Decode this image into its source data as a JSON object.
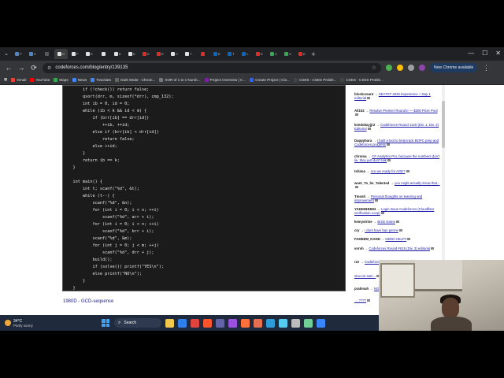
{
  "tabs": [
    {
      "title": "F",
      "color": "#4f86c6"
    },
    {
      "title": "C",
      "color": "#4f86c6"
    },
    {
      "title": "",
      "color": "#5a5a5a"
    },
    {
      "title": "G",
      "color": "#e0e0e0"
    },
    {
      "title": "F",
      "color": "#e0e0e0"
    },
    {
      "title": "E",
      "color": "#e0e0e0"
    },
    {
      "title": "",
      "color": "#e0e0e0"
    },
    {
      "title": "E",
      "color": "#e0e0e0"
    },
    {
      "title": "E",
      "color": "#e0e0e0"
    },
    {
      "title": "E",
      "color": "#d93025"
    },
    {
      "title": "E",
      "color": "#d93025"
    },
    {
      "title": "C",
      "color": "#e0e0e0"
    },
    {
      "title": "T",
      "color": "#e0e0e0"
    },
    {
      "title": "",
      "color": "#d93025"
    },
    {
      "title": "E",
      "color": "#0a66c2"
    },
    {
      "title": "T",
      "color": "#0a66c2"
    },
    {
      "title": "L",
      "color": "#0a66c2"
    },
    {
      "title": "E",
      "color": "#d93025"
    },
    {
      "title": "C",
      "color": "#34a853"
    },
    {
      "title": "C",
      "color": "#34a853"
    },
    {
      "title": "E",
      "color": "#d93025"
    }
  ],
  "browser": {
    "url": "codeforces.com/blog/entry/139135",
    "update_label": "New Chrome available"
  },
  "bookmarks": [
    {
      "label": "Gmail",
      "color": "#ea4335"
    },
    {
      "label": "YouTube",
      "color": "#ff0000"
    },
    {
      "label": "Maps",
      "color": "#34a853"
    },
    {
      "label": "News",
      "color": "#4285f4"
    },
    {
      "label": "Translate",
      "color": "#4285f4"
    },
    {
      "label": "Dark Mode - Chrom...",
      "color": "#666"
    },
    {
      "label": "XOR of 1 to n Numb...",
      "color": "#777"
    },
    {
      "label": "Project Overview | C...",
      "color": "#7b1fa2"
    },
    {
      "label": "Create Project | Clo...",
      "color": "#2962ff"
    },
    {
      "label": "CSES - CSES Proble...",
      "color": "#444"
    },
    {
      "label": "CSES - CSES Proble...",
      "color": "#444"
    }
  ],
  "code_lines": [
    "        if (!check()) return false;",
    "        qsort(drr, m, sizeof(*drr), cmp_132);",
    "        int ib = 0, id = 0;",
    "        while (ib < k && id < m) {",
    "            if (brr[ib] == drr[id])",
    "                ++ib, ++id;",
    "            else if (brr[ib] < drr[id])",
    "                return false;",
    "            else ++id;",
    "        }",
    "        return ib == k;",
    "    }",
    "",
    "    int main() {",
    "        int t; scanf(\"%d\", &t);",
    "        while (t--) {",
    "            scanf(\"%d\", &n);",
    "            for (int i = 0; i < n; ++i)",
    "                scanf(\"%d\", arr + i);",
    "            for (int i = 0; i < n; ++i)",
    "                scanf(\"%d\", brr + i);",
    "            scanf(\"%d\", &m);",
    "            for (int j = 0; j < m; ++j)",
    "                scanf(\"%d\", drr + j);",
    "            build();",
    "            if (solve()) printf(\"YES\\n\");",
    "            else printf(\"NO\\n\");",
    "        }",
    "    }"
  ],
  "problem_link": "1980D - GCD-sequence",
  "sidebar": [
    {
      "user": "blockcreant",
      "title": "SEATST 2026 Experience + Day 1 editorial"
    },
    {
      "user": "Ali102",
      "title": "Resolve Premier Round II — $300 Prize Pool"
    },
    {
      "user": "kendokayjjr2",
      "title": "Codeforces Round 1120 (Div. 1, Div. 2) Editorial"
    },
    {
      "user": "Dappybara",
      "title": "I built a tool to help track BOPC prep and Codeforces progress"
    },
    {
      "user": "chroma",
      "title": "CF Analytics Pro, because the numbers don't lie, they just don't talk"
    },
    {
      "user": "tshimo",
      "title": "Are we ready for AGE?"
    },
    {
      "user": "want_To_be_Talented",
      "title": "you might actually know that..."
    },
    {
      "user": "Tmosh",
      "title": "Personal thoughts on learning and improvement"
    },
    {
      "user": "YAHHHHHHH",
      "title": "Login Issue Codeforces (Cloudflare verification Loop)"
    },
    {
      "user": "kemystrine",
      "title": "Brick Game"
    },
    {
      "user": "cry",
      "title": "i dont have ban perms"
    },
    {
      "user": "FAHEEM_KAHH",
      "title": "NEED HELP!!"
    },
    {
      "user": "vnrvh",
      "title": "Codeforces Round #615 (Div. 3) editorial"
    },
    {
      "user": "rze",
      "title": "Codeforces Round 1114 (Div. 3) editorial"
    },
    {
      "user": "",
      "title": "stuv.cin.sam..."
    },
    {
      "user": "prahmah",
      "title": "NGO Open C..."
    },
    {
      "user": "",
      "title": "→ ????"
    }
  ],
  "taskbar": {
    "temp": "34°C",
    "condition": "Partly sunny",
    "search_label": "Search",
    "apps": [
      {
        "name": "file-explorer-icon",
        "color": "#f2c94c"
      },
      {
        "name": "vscode-icon",
        "color": "#2f80ed"
      },
      {
        "name": "chrome-icon",
        "color": "#e0443e"
      },
      {
        "name": "brave-icon",
        "color": "#fb542b"
      },
      {
        "name": "teams-icon",
        "color": "#6264a7"
      },
      {
        "name": "notes-icon",
        "color": "#9b51e0"
      },
      {
        "name": "firefox-icon",
        "color": "#ff7139"
      },
      {
        "name": "obs-icon",
        "color": "#e76f51"
      },
      {
        "name": "store-icon",
        "color": "#2d9cdb"
      },
      {
        "name": "photos-icon",
        "color": "#56ccf2"
      },
      {
        "name": "settings-icon",
        "color": "#bdbdbd"
      },
      {
        "name": "text-icon",
        "color": "#6fcf97"
      },
      {
        "name": "mail-icon",
        "color": "#3a86ff"
      }
    ]
  }
}
